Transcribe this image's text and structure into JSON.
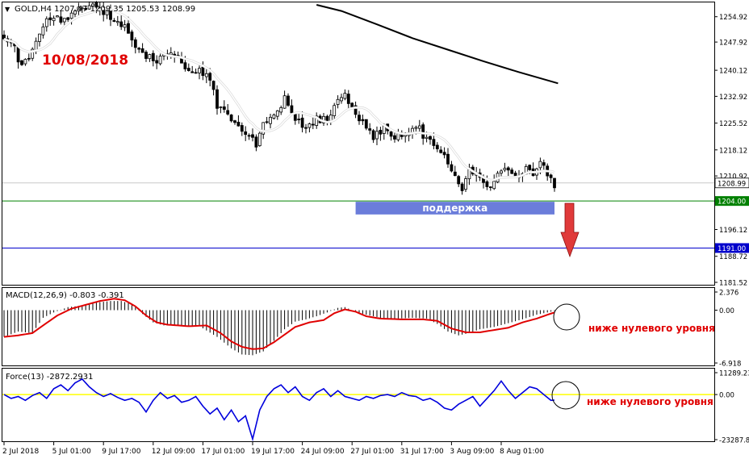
{
  "header": {
    "main_title": "GOLD,H4 1207.47 1209.35 1205.53 1208.99",
    "macd_title": "MACD(12,26,9) -0.803 -0.391",
    "force_title": "Force(13) -2872.2931"
  },
  "annotations": {
    "date": "10/08/2018",
    "support": "поддержка",
    "macd_note": "ниже нулевого уровня",
    "force_note": "ниже нулевого уровня"
  },
  "colors": {
    "bull": "#000000",
    "bear": "#000000",
    "ma_fast": "#ffffff",
    "ma_slow": "#000000",
    "support_line": "#008000",
    "target_line": "#0000cc",
    "support_box": "#5b6fd6",
    "arrow": "#e03a3a",
    "macd_signal": "#e00000",
    "force_line": "#0000dd",
    "force_zero": "#ffff00",
    "annotation": "#e00000"
  },
  "chart_data": [
    {
      "type": "candlestick",
      "panel": "price",
      "ylim": [
        1181.52,
        1258.2
      ],
      "y_ticks": [
        "1254.92",
        "1247.92",
        "1240.12",
        "1232.92",
        "1225.52",
        "1218.12",
        "1210.92",
        "1203.72",
        "1196.12",
        "1188.72",
        "1181.52"
      ],
      "current_price": "1208.99",
      "levels": [
        {
          "label": "1204.00",
          "value": 1204.0,
          "role": "support"
        },
        {
          "label": "1191.00",
          "value": 1191.0,
          "role": "target"
        }
      ],
      "support_zone": {
        "label": "поддержка",
        "from_index": 99,
        "to_index": 155,
        "low": 1200.5,
        "high": 1204.0
      },
      "x_labels": [
        {
          "label": "2 Jul 2018",
          "index": 0
        },
        {
          "label": "5 Jul 01:00",
          "index": 14
        },
        {
          "label": "9 Jul 17:00",
          "index": 28
        },
        {
          "label": "12 Jul 09:00",
          "index": 42
        },
        {
          "label": "17 Jul 01:00",
          "index": 56
        },
        {
          "label": "19 Jul 17:00",
          "index": 70
        },
        {
          "label": "24 Jul 09:00",
          "index": 84
        },
        {
          "label": "27 Jul 01:00",
          "index": 98
        },
        {
          "label": "31 Jul 17:00",
          "index": 112
        },
        {
          "label": "3 Aug 09:00",
          "index": 126
        },
        {
          "label": "8 Aug 01:00",
          "index": 140
        }
      ],
      "anchors_close": [
        [
          0,
          1249
        ],
        [
          3,
          1246
        ],
        [
          5,
          1241
        ],
        [
          7,
          1244
        ],
        [
          9,
          1249
        ],
        [
          11,
          1253
        ],
        [
          14,
          1255
        ],
        [
          17,
          1254
        ],
        [
          20,
          1256
        ],
        [
          23,
          1258
        ],
        [
          26,
          1257
        ],
        [
          29,
          1256
        ],
        [
          31,
          1254
        ],
        [
          34,
          1252
        ],
        [
          36,
          1249
        ],
        [
          38,
          1246
        ],
        [
          40,
          1244
        ],
        [
          43,
          1243
        ],
        [
          46,
          1245
        ],
        [
          49,
          1243
        ],
        [
          52,
          1240
        ],
        [
          55,
          1240
        ],
        [
          58,
          1238
        ],
        [
          60,
          1230
        ],
        [
          63,
          1228
        ],
        [
          66,
          1225
        ],
        [
          69,
          1222
        ],
        [
          71,
          1219
        ],
        [
          73,
          1226
        ],
        [
          76,
          1228
        ],
        [
          79,
          1232
        ],
        [
          82,
          1227
        ],
        [
          85,
          1224
        ],
        [
          88,
          1227
        ],
        [
          91,
          1226
        ],
        [
          94,
          1232
        ],
        [
          96,
          1233
        ],
        [
          98,
          1229
        ],
        [
          101,
          1226
        ],
        [
          104,
          1222
        ],
        [
          107,
          1224
        ],
        [
          110,
          1221
        ],
        [
          113,
          1223
        ],
        [
          116,
          1225
        ],
        [
          119,
          1221
        ],
        [
          122,
          1218
        ],
        [
          125,
          1215
        ],
        [
          127,
          1210
        ],
        [
          129,
          1206
        ],
        [
          131,
          1213
        ],
        [
          133,
          1212
        ],
        [
          135,
          1209
        ],
        [
          137,
          1207
        ],
        [
          139,
          1212
        ],
        [
          142,
          1213
        ],
        [
          145,
          1211
        ],
        [
          147,
          1213
        ],
        [
          149,
          1212
        ],
        [
          151,
          1214
        ],
        [
          153,
          1212
        ],
        [
          155,
          1208
        ]
      ],
      "ma_slow": [
        [
          88,
          1258.2
        ],
        [
          95,
          1256.5
        ],
        [
          105,
          1252.8
        ],
        [
          115,
          1249
        ],
        [
          125,
          1245.8
        ],
        [
          135,
          1242.6
        ],
        [
          145,
          1239.6
        ],
        [
          156,
          1236.5
        ]
      ]
    },
    {
      "type": "histogram+line",
      "panel": "macd",
      "name": "MACD(12,26,9)",
      "ylim": [
        -6.918,
        2.376
      ],
      "y_ticks": [
        "2.376",
        "0.00",
        "-6.918"
      ],
      "macd_anchors": [
        [
          0,
          -3.5
        ],
        [
          4,
          -2.8
        ],
        [
          8,
          -3.0
        ],
        [
          11,
          -1.0
        ],
        [
          14,
          -0.3
        ],
        [
          18,
          0.4
        ],
        [
          22,
          0.6
        ],
        [
          26,
          1.0
        ],
        [
          30,
          1.2
        ],
        [
          33,
          1.2
        ],
        [
          36,
          0.8
        ],
        [
          39,
          -0.5
        ],
        [
          42,
          -1.6
        ],
        [
          45,
          -2.0
        ],
        [
          50,
          -2.0
        ],
        [
          55,
          -2.1
        ],
        [
          60,
          -3.5
        ],
        [
          64,
          -5.0
        ],
        [
          67,
          -5.8
        ],
        [
          70,
          -5.9
        ],
        [
          73,
          -5.4
        ],
        [
          76,
          -4.0
        ],
        [
          79,
          -2.5
        ],
        [
          82,
          -1.5
        ],
        [
          85,
          -1.2
        ],
        [
          88,
          -0.8
        ],
        [
          91,
          -0.3
        ],
        [
          94,
          0.3
        ],
        [
          96,
          0.4
        ],
        [
          99,
          -0.2
        ],
        [
          102,
          -0.6
        ],
        [
          106,
          -1.0
        ],
        [
          111,
          -1.1
        ],
        [
          115,
          -1.0
        ],
        [
          119,
          -1.1
        ],
        [
          122,
          -1.8
        ],
        [
          125,
          -2.8
        ],
        [
          128,
          -3.3
        ],
        [
          131,
          -3.0
        ],
        [
          134,
          -2.5
        ],
        [
          138,
          -2.2
        ],
        [
          142,
          -1.7
        ],
        [
          146,
          -1.2
        ],
        [
          150,
          -0.6
        ],
        [
          153,
          -0.3
        ],
        [
          155,
          -0.1
        ]
      ],
      "signal_anchors": [
        [
          0,
          -3.5
        ],
        [
          4,
          -3.3
        ],
        [
          8,
          -3.0
        ],
        [
          11,
          -2.0
        ],
        [
          15,
          -0.7
        ],
        [
          19,
          0.2
        ],
        [
          23,
          0.7
        ],
        [
          27,
          1.2
        ],
        [
          31,
          1.5
        ],
        [
          34,
          1.3
        ],
        [
          37,
          0.5
        ],
        [
          40,
          -0.7
        ],
        [
          43,
          -1.6
        ],
        [
          46,
          -1.9
        ],
        [
          52,
          -2.1
        ],
        [
          57,
          -2.0
        ],
        [
          61,
          -3.0
        ],
        [
          64,
          -4.1
        ],
        [
          67,
          -4.8
        ],
        [
          70,
          -5.1
        ],
        [
          73,
          -5.0
        ],
        [
          76,
          -4.2
        ],
        [
          79,
          -3.2
        ],
        [
          82,
          -2.2
        ],
        [
          86,
          -1.6
        ],
        [
          90,
          -1.3
        ],
        [
          93,
          -0.4
        ],
        [
          96,
          0.1
        ],
        [
          99,
          -0.2
        ],
        [
          102,
          -0.8
        ],
        [
          106,
          -1.1
        ],
        [
          112,
          -1.2
        ],
        [
          118,
          -1.2
        ],
        [
          122,
          -1.4
        ],
        [
          126,
          -2.4
        ],
        [
          130,
          -2.9
        ],
        [
          134,
          -2.9
        ],
        [
          138,
          -2.6
        ],
        [
          142,
          -2.3
        ],
        [
          146,
          -1.6
        ],
        [
          150,
          -1.1
        ],
        [
          153,
          -0.6
        ],
        [
          155,
          -0.3
        ]
      ]
    },
    {
      "type": "line",
      "panel": "force",
      "name": "Force(13)",
      "ylim": [
        -23287.85,
        11289.23
      ],
      "y_ticks": [
        "11289.23",
        "0.00",
        "-23287.85"
      ],
      "anchors": [
        [
          0,
          0
        ],
        [
          2,
          -2000
        ],
        [
          4,
          -1000
        ],
        [
          6,
          -3000
        ],
        [
          8,
          -500
        ],
        [
          10,
          1000
        ],
        [
          12,
          -2000
        ],
        [
          14,
          3000
        ],
        [
          16,
          5000
        ],
        [
          18,
          2000
        ],
        [
          20,
          6000
        ],
        [
          22,
          8000
        ],
        [
          24,
          4000
        ],
        [
          26,
          1000
        ],
        [
          28,
          -1000
        ],
        [
          30,
          500
        ],
        [
          32,
          -1500
        ],
        [
          34,
          -3000
        ],
        [
          36,
          -2000
        ],
        [
          38,
          -4000
        ],
        [
          40,
          -9000
        ],
        [
          42,
          -3000
        ],
        [
          44,
          1000
        ],
        [
          46,
          -2000
        ],
        [
          48,
          -500
        ],
        [
          50,
          -4000
        ],
        [
          52,
          -3000
        ],
        [
          54,
          -1000
        ],
        [
          56,
          -6000
        ],
        [
          58,
          -10000
        ],
        [
          60,
          -7000
        ],
        [
          62,
          -13000
        ],
        [
          64,
          -8000
        ],
        [
          66,
          -14000
        ],
        [
          68,
          -11000
        ],
        [
          70,
          -23000
        ],
        [
          72,
          -8000
        ],
        [
          74,
          -1000
        ],
        [
          76,
          3000
        ],
        [
          78,
          5000
        ],
        [
          80,
          1000
        ],
        [
          82,
          4000
        ],
        [
          84,
          -1000
        ],
        [
          86,
          -3000
        ],
        [
          88,
          1000
        ],
        [
          90,
          3000
        ],
        [
          92,
          -1000
        ],
        [
          94,
          2000
        ],
        [
          96,
          -1000
        ],
        [
          98,
          -2000
        ],
        [
          100,
          -3000
        ],
        [
          102,
          -1000
        ],
        [
          104,
          -2000
        ],
        [
          106,
          -500
        ],
        [
          108,
          0
        ],
        [
          110,
          -1000
        ],
        [
          112,
          1000
        ],
        [
          114,
          -500
        ],
        [
          116,
          -1000
        ],
        [
          118,
          -3000
        ],
        [
          120,
          -2000
        ],
        [
          122,
          -4000
        ],
        [
          124,
          -7000
        ],
        [
          126,
          -8000
        ],
        [
          128,
          -5000
        ],
        [
          130,
          -3000
        ],
        [
          132,
          -1000
        ],
        [
          134,
          -6000
        ],
        [
          136,
          -2000
        ],
        [
          138,
          2000
        ],
        [
          140,
          7000
        ],
        [
          142,
          2000
        ],
        [
          144,
          -2000
        ],
        [
          146,
          1000
        ],
        [
          148,
          4000
        ],
        [
          150,
          3000
        ],
        [
          152,
          0
        ],
        [
          154,
          -3000
        ],
        [
          155,
          -2872
        ]
      ]
    }
  ]
}
